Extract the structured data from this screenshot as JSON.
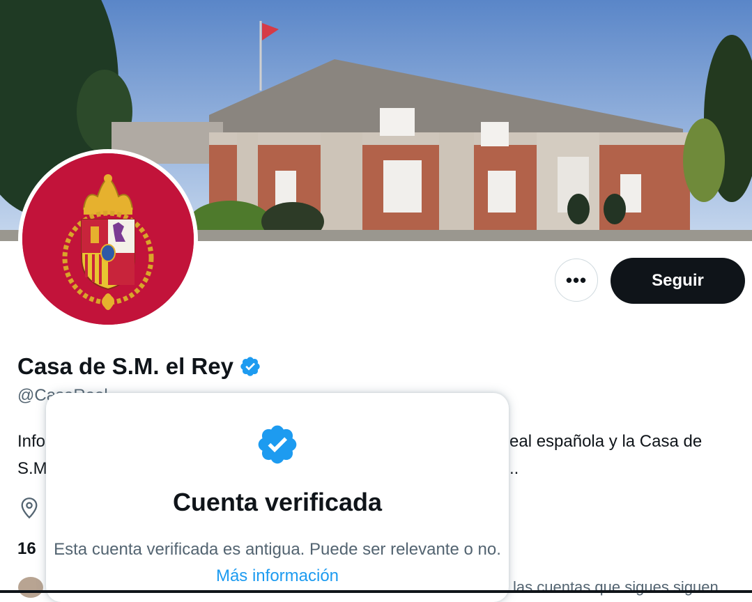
{
  "profile": {
    "name": "Casa de S.M. el Rey",
    "handle": "@CasaReal",
    "bio_line1_start": "Info",
    "bio_line1_end": "eal española y la Casa de",
    "bio_line2_start": "S.M",
    "bio_line2_end": "..",
    "stat_start": "16",
    "followers_note": "las cuentas que sigues siguen"
  },
  "actions": {
    "more_label": "•••",
    "follow_label": "Seguir"
  },
  "verified_popup": {
    "title": "Cuenta verificada",
    "text": "Esta cuenta verificada es antigua. Puede ser relevante o no.",
    "link": "Más información"
  },
  "icons": {
    "verified": "verified-badge-icon",
    "location": "location-pin-icon",
    "more": "more-options-icon"
  },
  "colors": {
    "accent": "#1d9bf0",
    "follow_button": "#0f1419",
    "avatar_background": "#c2133a"
  }
}
